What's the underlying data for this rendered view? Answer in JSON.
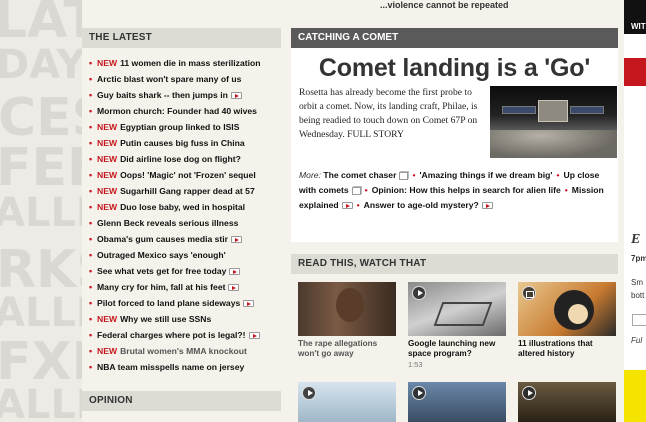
{
  "top_strip_text": "...violence cannot be repeated",
  "background_letters": [
    "LAT",
    "DAY.N",
    "CES",
    "FEF",
    "ALLI",
    "RKS",
    "ALLE",
    "FXF",
    "ALLE"
  ],
  "latest": {
    "heading": "THE LATEST",
    "items": [
      {
        "new": "NEW",
        "text": "11 women die in mass sterilization",
        "icon": ""
      },
      {
        "new": "",
        "text": "Arctic blast won't spare many of us",
        "icon": ""
      },
      {
        "new": "",
        "text": "Guy baits shark -- then jumps in",
        "icon": "video-icon"
      },
      {
        "new": "",
        "text": "Mormon church: Founder had 40 wives",
        "icon": ""
      },
      {
        "new": "NEW",
        "text": "Egyptian group linked to ISIS",
        "icon": ""
      },
      {
        "new": "NEW",
        "text": "Putin causes big fuss in China",
        "icon": ""
      },
      {
        "new": "NEW",
        "text": "Did airline lose dog on flight?",
        "icon": ""
      },
      {
        "new": "NEW",
        "text": "Oops! 'Magic' not 'Frozen' sequel",
        "icon": ""
      },
      {
        "new": "NEW",
        "text": "Sugarhill Gang rapper dead at 57",
        "icon": ""
      },
      {
        "new": "NEW",
        "text": "Duo lose baby, wed in hospital",
        "icon": ""
      },
      {
        "new": "",
        "text": "Glenn Beck reveals serious illness",
        "icon": ""
      },
      {
        "new": "",
        "text": "Obama's gum causes media stir",
        "icon": "video-icon"
      },
      {
        "new": "",
        "text": "Outraged Mexico says 'enough'",
        "icon": ""
      },
      {
        "new": "",
        "text": "See what vets get for free today",
        "icon": "video-icon"
      },
      {
        "new": "",
        "text": "Many cry for him, fall at his feet",
        "icon": "video-icon"
      },
      {
        "new": "",
        "text": "Pilot forced to land plane sideways",
        "icon": "video-icon"
      },
      {
        "new": "NEW",
        "text": "Why we still use SSNs",
        "icon": ""
      },
      {
        "new": "",
        "text": "Federal charges where pot is legal?!",
        "icon": "video-icon"
      },
      {
        "new": "NEW",
        "text": "Brutal women's MMA knockout",
        "icon": "",
        "gray": true
      },
      {
        "new": "",
        "text": "NBA team misspells name on jersey",
        "icon": ""
      }
    ]
  },
  "opinion": {
    "heading": "OPINION"
  },
  "comet": {
    "heading": "CATCHING A COMET",
    "headline": "Comet landing is a 'Go'",
    "body": "Rosetta has already become the first probe to orbit a comet. Now, its landing craft, Philae, is being readied to touch down on Comet 67P on Wednesday. FULL STORY",
    "more_label": "More:",
    "more_links": [
      {
        "text": "The comet chaser",
        "icon": "gallery-icon"
      },
      {
        "text": "'Amazing things if we dream big'",
        "icon": ""
      },
      {
        "text": "Up close with comets",
        "icon": "gallery-icon"
      },
      {
        "text": "Opinion: How this helps in search for alien life",
        "icon": ""
      },
      {
        "text": "Mission explained",
        "icon": "video-icon"
      },
      {
        "text": "Answer to age-old mystery?",
        "icon": "video-icon"
      }
    ]
  },
  "read_watch": {
    "heading": "READ THIS, WATCH THAT",
    "thumbs": [
      {
        "caption": "The rape allegations won't go away",
        "duration": "",
        "icon": "",
        "gray": true
      },
      {
        "caption": "Google launching new space program?",
        "duration": "1:53",
        "icon": "play-icon"
      },
      {
        "caption": "11 illustrations that altered history",
        "duration": "",
        "icon": "gallery-icon"
      }
    ],
    "row2_icons": [
      "play-icon",
      "play-icon",
      "play-icon"
    ]
  },
  "right_column": {
    "texts": [
      "WIT",
      "E",
      "7pm",
      "Sm",
      "bott",
      "Ful"
    ],
    "colors": {
      "red": "#c4161c",
      "yellow": "#f5e400"
    }
  },
  "colors": {
    "accent_red": "#c4161c",
    "section_gray": "#dcdcd5",
    "dark_header": "#5a5a5a"
  }
}
